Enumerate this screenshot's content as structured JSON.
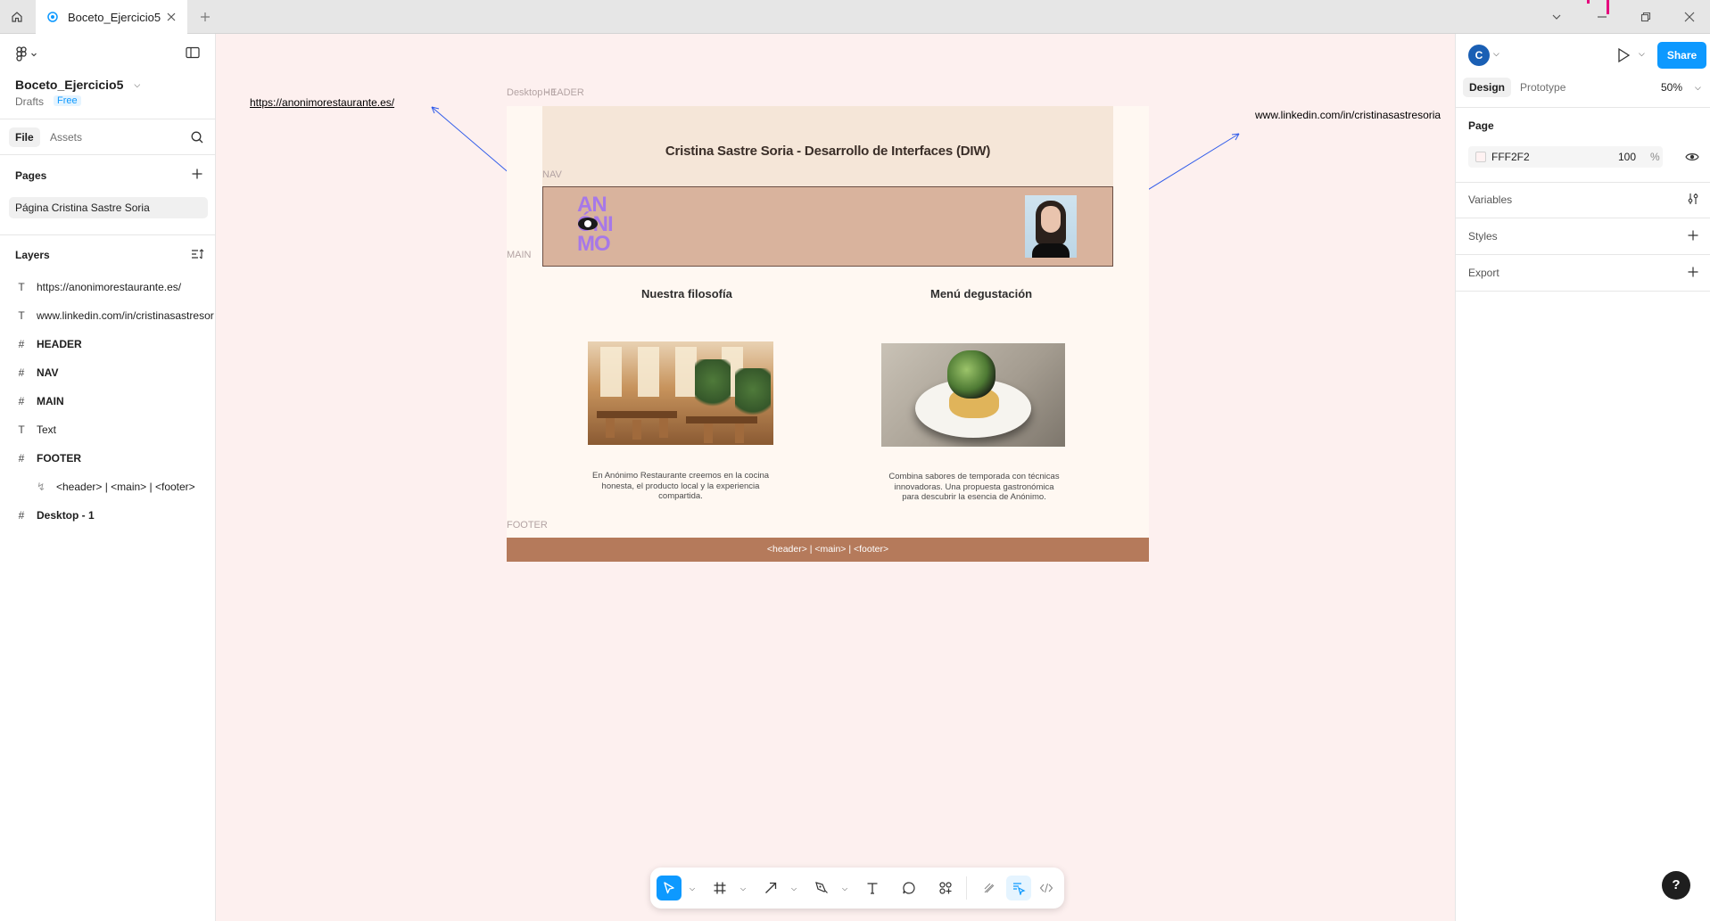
{
  "tabbar": {
    "tab_title": "Boceto_Ejercicio5"
  },
  "left_panel": {
    "file_name": "Boceto_Ejercicio5",
    "location": "Drafts",
    "plan_badge": "Free",
    "tabs": {
      "file": "File",
      "assets": "Assets"
    },
    "pages_heading": "Pages",
    "pages": [
      "Página Cristina Sastre Soria"
    ],
    "layers_heading": "Layers",
    "layers": [
      {
        "type": "text",
        "label": "https://anonimorestaurante.es/"
      },
      {
        "type": "text",
        "label": "www.linkedin.com/in/cristinasastresor"
      },
      {
        "type": "frame",
        "label": "HEADER"
      },
      {
        "type": "frame",
        "label": "NAV"
      },
      {
        "type": "frame",
        "label": "MAIN"
      },
      {
        "type": "text",
        "label": "Text"
      },
      {
        "type": "frame",
        "label": "FOOTER"
      },
      {
        "type": "component",
        "label": "<header> | <main> | <footer>"
      },
      {
        "type": "frame",
        "label": "Desktop - 1"
      }
    ]
  },
  "right_panel": {
    "avatar_initial": "C",
    "share_label": "Share",
    "tabs": {
      "design": "Design",
      "prototype": "Prototype"
    },
    "zoom": "50%",
    "page_heading": "Page",
    "page_color_hex": "FFF2F2",
    "page_opacity": "100",
    "page_opacity_unit": "%",
    "variables_label": "Variables",
    "styles_label": "Styles",
    "export_label": "Export"
  },
  "canvas": {
    "link_left": "https://anonimorestaurante.es/",
    "link_right": "www.linkedin.com/in/cristinasastresoria",
    "frame_labels": {
      "desktop": "Desktop - 1",
      "header": "HEADER",
      "nav": "NAV",
      "main": "MAIN",
      "footer": "FOOTER"
    },
    "header_title": "Cristina Sastre Soria  - Desarrollo de Interfaces (DIW)",
    "logo_text": [
      "AN",
      "ÓNI",
      "MO"
    ],
    "sections": [
      {
        "title": "Nuestra filosofía",
        "text": "En Anónimo Restaurante creemos en la cocina honesta, el producto local y la experiencia compartida."
      },
      {
        "title": "Menú degustación",
        "text": "Combina sabores de temporada con técnicas innovadoras. Una propuesta gastronómica para descubrir la esencia de Anónimo."
      }
    ],
    "footer_text": "<header> | <main> | <footer>",
    "colors": {
      "canvas_bg": "#FDF0EF",
      "header_bg": "#F5E6D8",
      "nav_bg": "#D9B39D",
      "footer_bg": "#B57A5B",
      "logo": "#A678E8",
      "arrow": "#2F5BEA",
      "accent": "#0D99FF"
    }
  },
  "toolbar": {
    "tools": [
      "move-tool",
      "frame-tool",
      "shape-tool",
      "pen-tool",
      "text-tool",
      "comment-tool",
      "actions-tool",
      "draw-mode",
      "design-mode",
      "dev-mode"
    ]
  }
}
